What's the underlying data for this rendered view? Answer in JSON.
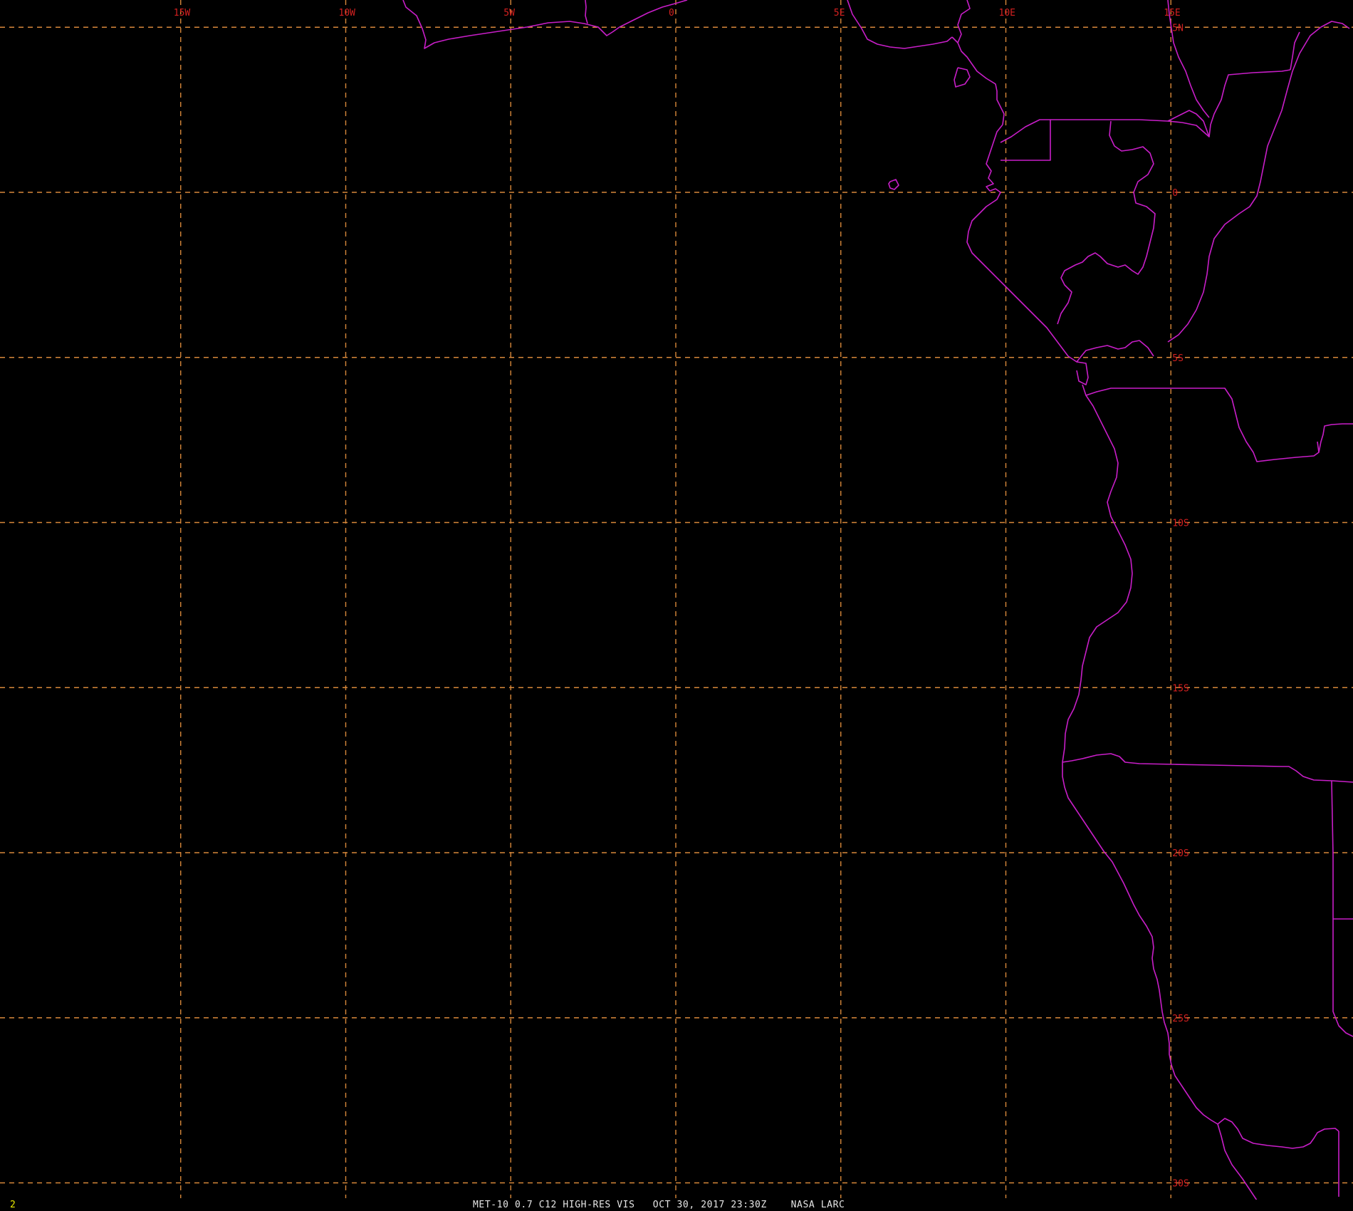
{
  "image": {
    "background": "#000000",
    "grid_color": "#d8883a",
    "boundary_color": "#c81ec8",
    "label_color": "#d42020"
  },
  "map": {
    "longitude_labels": [
      "15W",
      "10W",
      "5W",
      "0",
      "5E",
      "10E",
      "15E"
    ],
    "latitude_labels": [
      "5N",
      "0",
      "5S",
      "10S",
      "15S",
      "20S",
      "25S",
      "30S"
    ],
    "longitudes": [
      -15,
      -10,
      -5,
      0,
      5,
      10,
      15
    ],
    "latitudes": [
      5,
      0,
      -5,
      -10,
      -15,
      -20,
      -25,
      -30
    ]
  },
  "status_bar": {
    "frame_number": "2",
    "caption": "MET-10 0.7 C12 HIGH-RES VIS   OCT 30, 2017 23:30Z    NASA LARC"
  }
}
